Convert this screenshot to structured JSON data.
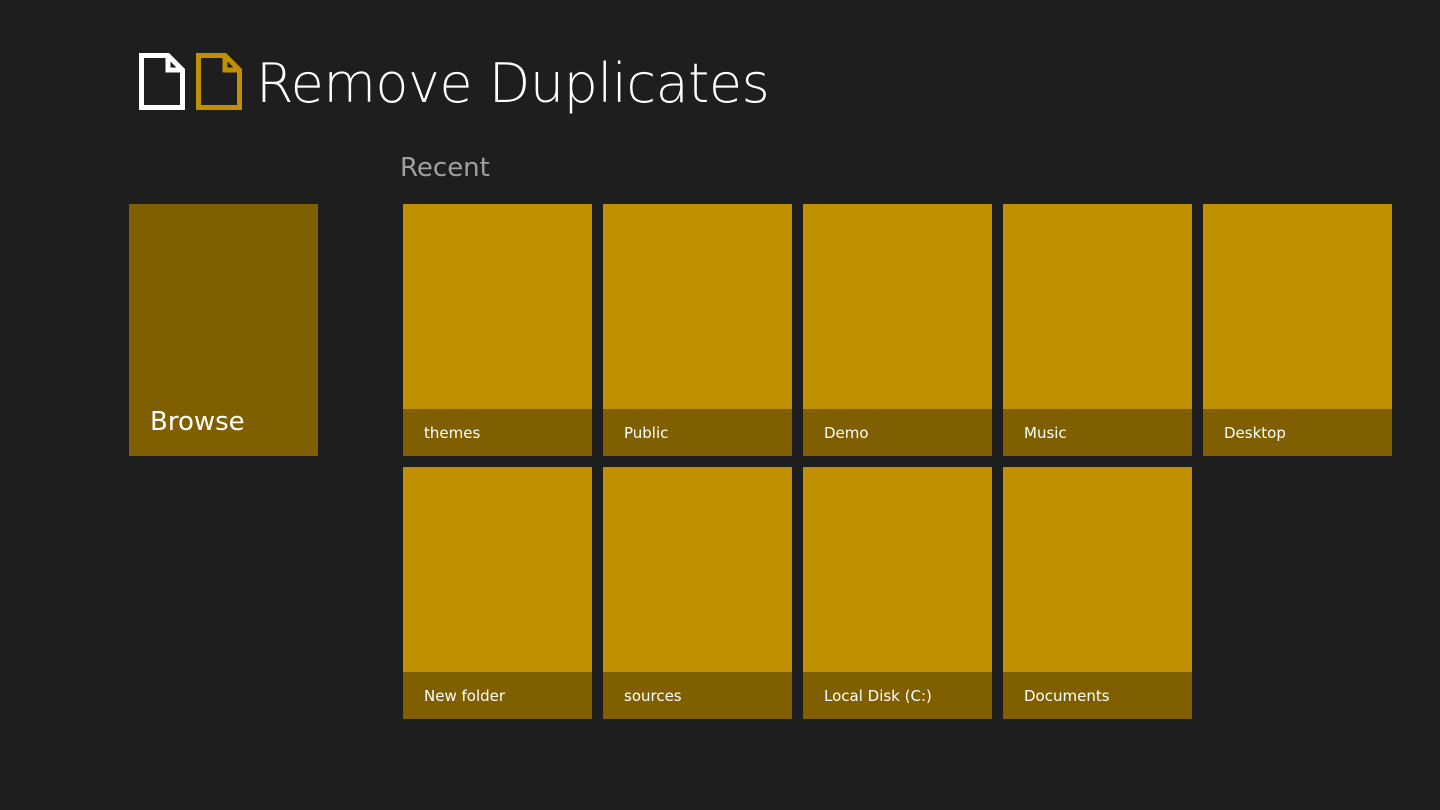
{
  "app": {
    "title": "Remove Duplicates",
    "logo_icon": "duplicate-documents-icon",
    "colors": {
      "background": "#1e1e1e",
      "tile": "#c09000",
      "tile_caption": "#7f5f00",
      "section_title": "#a0a0a0"
    }
  },
  "browse": {
    "label": "Browse"
  },
  "recent": {
    "title": "Recent",
    "items": [
      {
        "label": "themes"
      },
      {
        "label": "Public"
      },
      {
        "label": "Demo"
      },
      {
        "label": "Music"
      },
      {
        "label": "Desktop"
      },
      {
        "label": "New folder"
      },
      {
        "label": "sources"
      },
      {
        "label": "Local Disk (C:)"
      },
      {
        "label": "Documents"
      }
    ]
  }
}
